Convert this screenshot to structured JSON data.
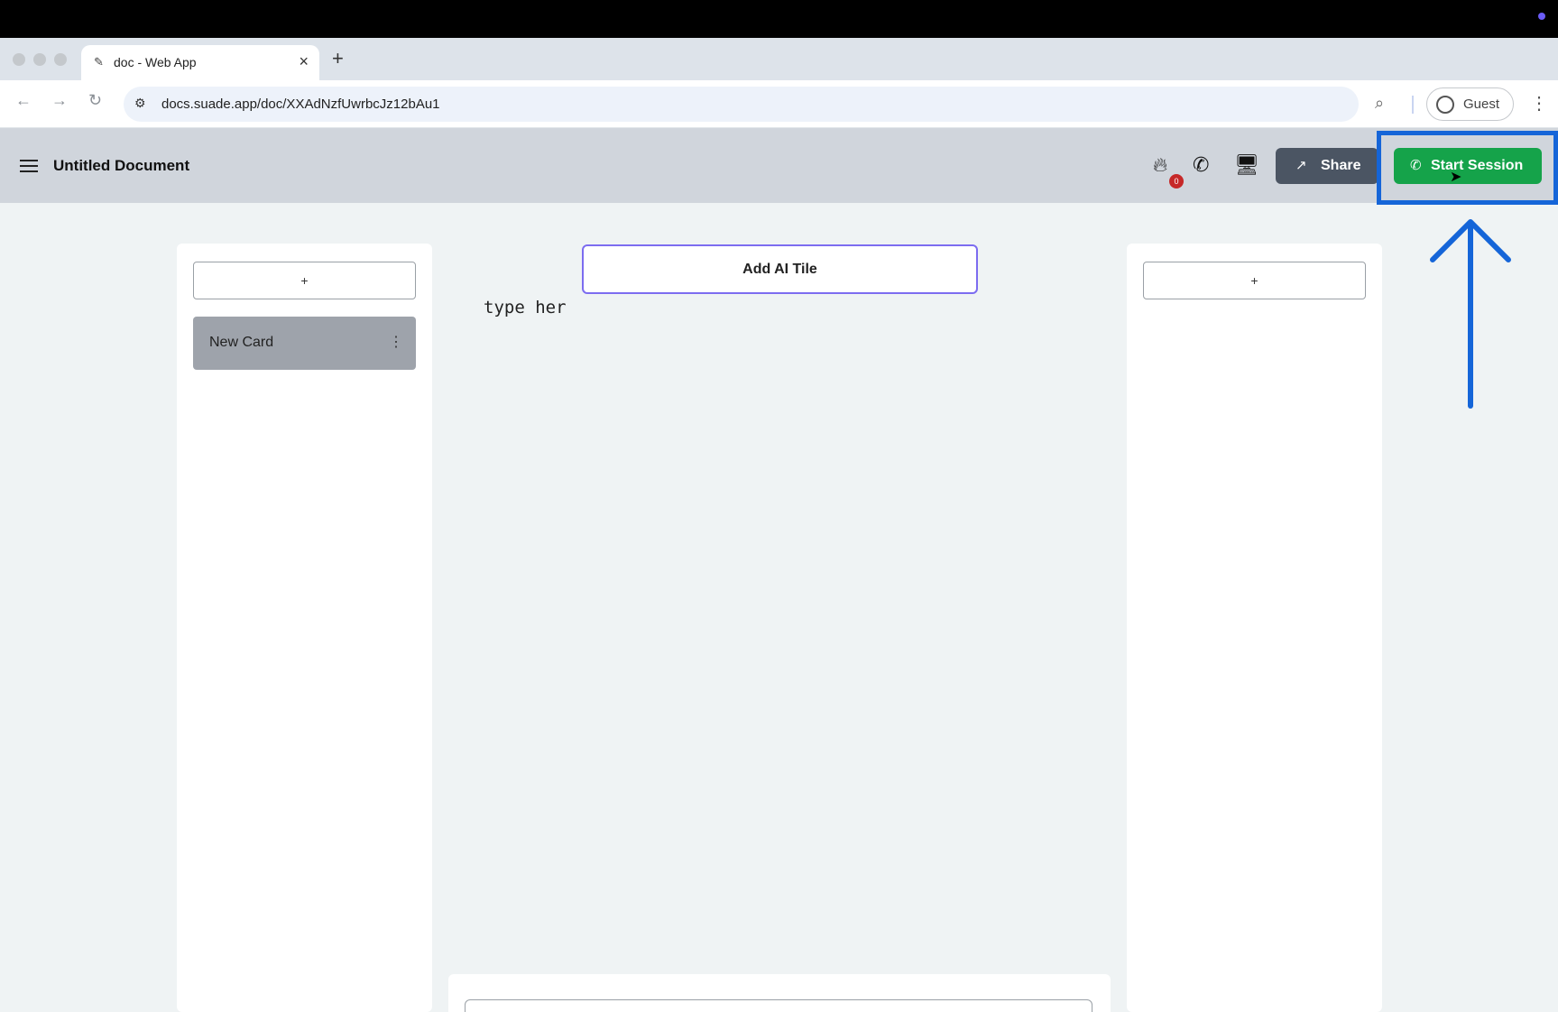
{
  "browser": {
    "tab_title": "doc - Web App",
    "url": "docs.suade.app/doc/XXAdNzfUwrbcJz12bAu1",
    "profile_label": "Guest"
  },
  "header": {
    "title": "Untitled Document",
    "badge_count": "0",
    "share_label": "Share",
    "start_session_label": "Start Session"
  },
  "left_column": {
    "add_label": "+",
    "cards": [
      {
        "title": "New Card"
      }
    ]
  },
  "right_column": {
    "add_label": "+"
  },
  "center": {
    "ai_tile_label": "Add AI Tile",
    "editor_text": "type her"
  },
  "colors": {
    "start_session": "#15a34a",
    "share": "#4b5563",
    "highlight": "#1565d8"
  }
}
